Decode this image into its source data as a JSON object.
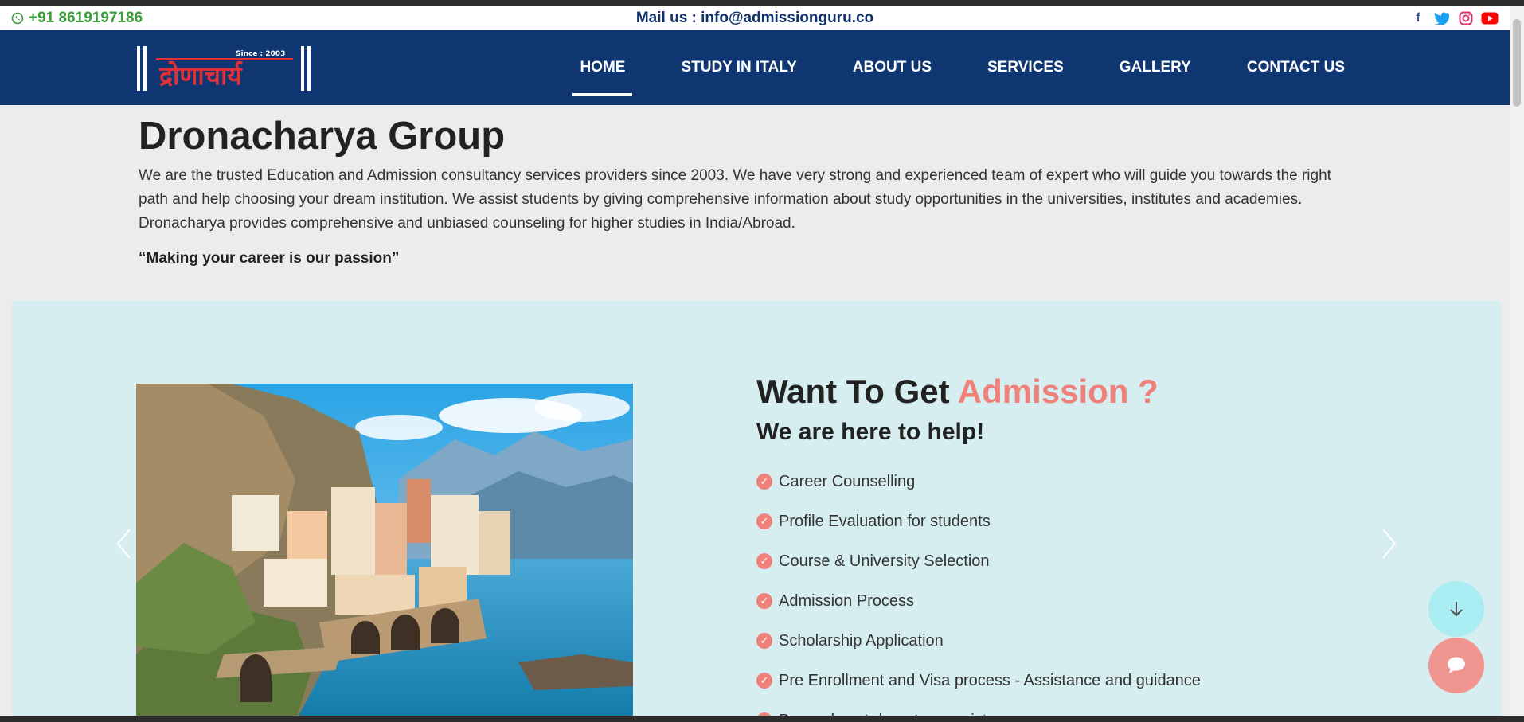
{
  "topbar": {
    "phone": "+91 8619197186",
    "mail": "Mail us : info@admissionguru.co",
    "social_icons": [
      "facebook-icon",
      "twitter-icon",
      "instagram-icon",
      "youtube-icon"
    ],
    "colors": {
      "phone": "#3a9d3a",
      "mail": "#10316b",
      "facebook": "#3b5998",
      "twitter": "#1da1f2",
      "instagram": "#e1306c",
      "youtube": "#ff0000"
    }
  },
  "navbar": {
    "logo": {
      "since": "Since : 2003",
      "name": "द्रोणाचार्य"
    },
    "items": [
      {
        "label": "HOME",
        "active": true
      },
      {
        "label": "STUDY IN ITALY"
      },
      {
        "label": "ABOUT US"
      },
      {
        "label": "SERVICES"
      },
      {
        "label": "GALLERY"
      },
      {
        "label": "CONTACT US"
      }
    ],
    "background": "#0f3670"
  },
  "about": {
    "title": "Dronacharya Group",
    "description": "We are the trusted Education and Admission consultancy services providers since 2003. We have very strong and experienced team of expert who will guide you towards the right path and help choosing your dream institution. We assist students by giving comprehensive information about study opportunities in the universities, institutes and academies. Dronacharya provides comprehensive and unbiased counseling for higher studies in India/Abroad.",
    "quote": "“Making your career is our passion”"
  },
  "admission": {
    "heading_prefix": "Want To Get ",
    "heading_accent": "Admission ?",
    "subheading": "We are here to help!",
    "services": [
      "Career Counselling",
      "Profile Evaluation for students",
      "Course & University Selection",
      "Admission Process",
      "Scholarship Application",
      "Pre Enrollment and Visa process - Assistance and guidance",
      "Pre and post departure assistance"
    ],
    "accent_color": "#f0807a",
    "background": "#d6eeef"
  },
  "fabs": {
    "scroll_down_icon": "arrow-down-icon",
    "chat_icon": "chat-bubble-icon"
  }
}
